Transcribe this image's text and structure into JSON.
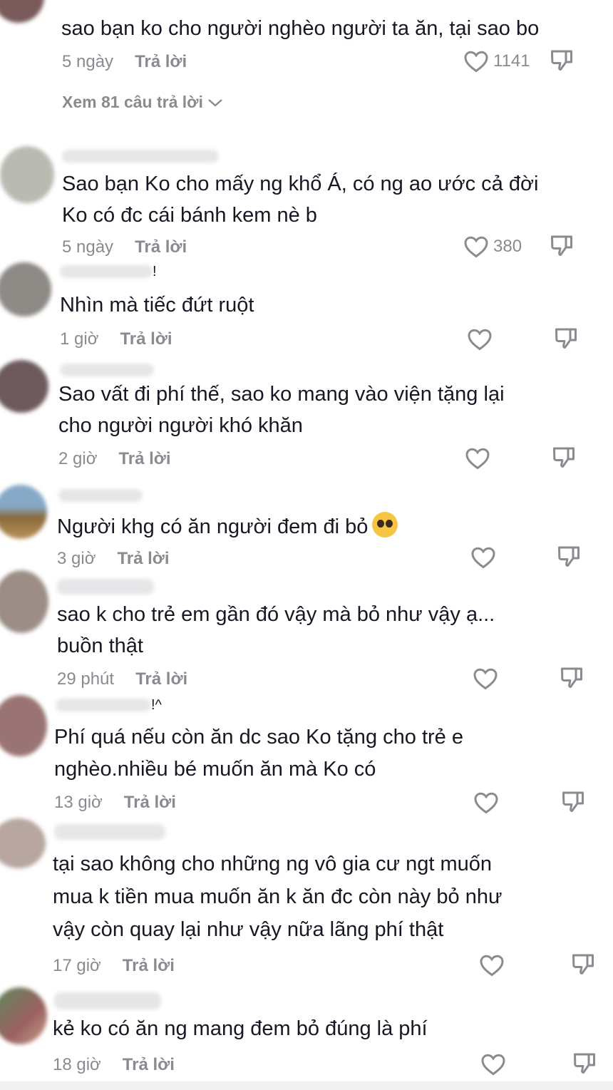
{
  "comments": [
    {
      "text": "sao bạn ko cho người nghèo người ta ăn, tại sao bo",
      "time": "5 ngày",
      "reply": "Trả lời",
      "likes": "1141"
    },
    {
      "text_lines": [
        "Sao bạn Ko cho mấy ng khổ Á, có ng ao ước cả đời",
        "Ko có đc cái bánh kem nè b"
      ],
      "time": "5 ngày",
      "reply": "Trả lời",
      "likes": "380"
    },
    {
      "text": "Nhìn mà tiếc đứt ruột",
      "time": "1 giờ",
      "reply": "Trả lời",
      "likes": ""
    },
    {
      "text_lines": [
        "Sao vất đi phí thế, sao ko mang vào viện tặng lại",
        "cho người người khó khăn"
      ],
      "time": "2 giờ",
      "reply": "Trả lời",
      "likes": ""
    },
    {
      "text": "Người khg có ăn người đem đi bỏ",
      "emoji": "pleading-face",
      "time": "3 giờ",
      "reply": "Trả lời",
      "likes": ""
    },
    {
      "text_lines": [
        "sao k cho trẻ em gần đó vậy mà bỏ như vậy ạ...",
        "buồn thật"
      ],
      "time": "29 phút",
      "reply": "Trả lời",
      "likes": ""
    },
    {
      "text_lines": [
        "Phí quá nếu còn ăn dc sao Ko tặng cho trẻ e",
        "nghèo.nhiều bé muốn ăn mà Ko có"
      ],
      "time": "13 giờ",
      "reply": "Trả lời",
      "likes": ""
    },
    {
      "text_lines": [
        "tại sao không cho những ng vô gia cư ngt muốn",
        "mua k tiền mua muốn ăn k ăn đc còn này bỏ như",
        "vậy còn quay lại như vậy nữa lãng phí thật"
      ],
      "time": "17 giờ",
      "reply": "Trả lời",
      "likes": ""
    },
    {
      "text": "kẻ ko có ăn ng mang đem bỏ đúng là phí",
      "time": "18 giờ",
      "reply": "Trả lời",
      "likes": ""
    }
  ],
  "view_replies": "Xem 81 câu trả lời",
  "username_fragments": {
    "c3": "!",
    "c7": "!^"
  },
  "icons": {
    "like": "heart-outline-icon",
    "dislike": "thumbs-down-icon",
    "expand": "chevron-down-icon"
  },
  "colors": {
    "text": "#161823",
    "meta": "#8a8b91"
  }
}
